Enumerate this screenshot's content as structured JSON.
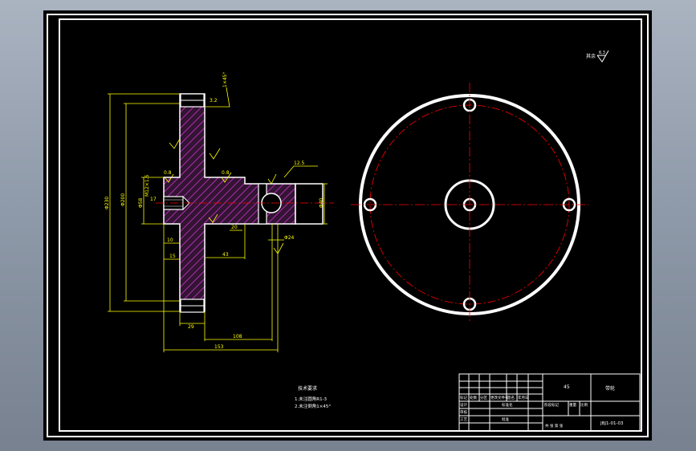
{
  "drawing": {
    "surface_finish_note": {
      "symbol": "其余",
      "value": "6.3"
    },
    "colors": {
      "background": "#000000",
      "outline": "#ffffff",
      "dimension": "#ffff00",
      "centerline": "#ff0000",
      "hatch": "#ff00ff"
    },
    "dimensions": {
      "overall_diameter": "Φ230",
      "step_diameter": "Φ200",
      "hub_diameter": "Φ58",
      "bore": "M12×1.5",
      "shaft_end": "Φ40",
      "hole_diameter": "Φ24",
      "chamfer": "1×45°",
      "seat_width": "15",
      "shoulder": "10",
      "flange_thickness": "20",
      "rim_width": "29",
      "offset": "43",
      "mid_length": "108",
      "overall_length": "153",
      "roughness_a": "0.8",
      "roughness_b": "0.8",
      "roughness_c": "3.2",
      "roughness_d": "12.5",
      "thread_depth": "17"
    },
    "technical_requirements": {
      "title": "技术要求",
      "lines": [
        "1.未注圆角R1-3",
        "2.未注倒角1×45°"
      ]
    },
    "title_block": {
      "part_name": "带轮",
      "material_code": "45",
      "drawing_number": "JBJ1-01-03",
      "labels": {
        "mark": "标记",
        "count": "处数",
        "zone": "分区",
        "change_doc": "更改文件号",
        "signature": "签名",
        "date": "年月日",
        "design": "设计",
        "standardize": "标准化",
        "review": "审核",
        "process": "工艺",
        "approve": "批准",
        "stage_mark": "阶段标记",
        "weight": "重量",
        "scale": "比例",
        "sheet_info": "共 张  第 张"
      }
    }
  }
}
